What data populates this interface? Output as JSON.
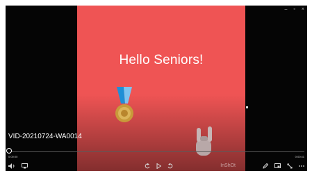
{
  "window": {
    "controls": {
      "minimize": "–",
      "maximize": "▫",
      "close": "×"
    }
  },
  "video": {
    "headline": "Hello Seniors!",
    "title": "VID-20210724-WA0014",
    "watermark": "InShOt",
    "background_color": "#ef5454"
  },
  "playback": {
    "current_time": "0:00:00",
    "total_time": "0:00:41",
    "progress": 0.0
  },
  "icons": {
    "left": [
      "volume-icon",
      "cast-icon"
    ],
    "center": [
      "rewind-icon",
      "play-icon",
      "forward-icon"
    ],
    "right": [
      "edit-icon",
      "mini-view-icon",
      "fullscreen-icon",
      "more-icon"
    ]
  }
}
